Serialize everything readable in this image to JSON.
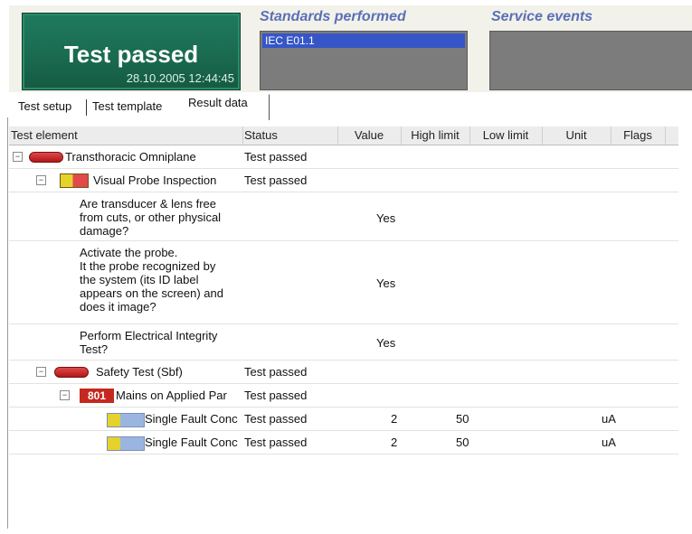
{
  "header": {
    "status_text": "Test passed",
    "status_timestamp": "28.10.2005 12:44:45",
    "standards_title": "Standards performed",
    "standards_items": [
      "IEC E01.1"
    ],
    "service_title": "Service events"
  },
  "tabs": [
    {
      "label": "Test setup"
    },
    {
      "label": "Test template"
    },
    {
      "label": "Result data"
    }
  ],
  "table": {
    "columns": [
      "Test element",
      "Status",
      "Value",
      "High limit",
      "Low limit",
      "Unit",
      "Flags"
    ],
    "rows": [
      {
        "element": "Transthoracic Omniplane",
        "status": "Test passed",
        "value": "",
        "high": "",
        "low": "",
        "unit": "",
        "flags": ""
      },
      {
        "element": "Visual Probe Inspection",
        "status": "Test passed",
        "value": "",
        "high": "",
        "low": "",
        "unit": "",
        "flags": ""
      },
      {
        "element": "Are transducer & lens free\nfrom cuts, or other physical\ndamage?",
        "status": "",
        "value": "Yes",
        "high": "",
        "low": "",
        "unit": "",
        "flags": ""
      },
      {
        "element": "Activate the probe.\nIt the probe recognized by\nthe system (its ID label\nappears on the screen) and\ndoes it image?",
        "status": "",
        "value": "Yes",
        "high": "",
        "low": "",
        "unit": "",
        "flags": ""
      },
      {
        "element": "Perform Electrical Integrity\nTest?",
        "status": "",
        "value": "Yes",
        "high": "",
        "low": "",
        "unit": "",
        "flags": ""
      },
      {
        "element": "Safety Test (Sbf)",
        "status": "Test passed",
        "value": "",
        "high": "",
        "low": "",
        "unit": "",
        "flags": ""
      },
      {
        "element": "Mains on Applied Par",
        "status": "Test passed",
        "value": "",
        "high": "",
        "low": "",
        "unit": "",
        "flags": ""
      },
      {
        "element": "Single Fault Conc",
        "status": "Test passed",
        "value": "2",
        "high": "50",
        "low": "",
        "unit": "uA",
        "flags": ""
      },
      {
        "element": "Single Fault Conc",
        "status": "Test passed",
        "value": "2",
        "high": "50",
        "low": "",
        "unit": "uA",
        "flags": ""
      }
    ]
  },
  "icons": {
    "expand": "minus-expander-icon",
    "device": "probe-device-icon",
    "visual": "visual-inspection-icon",
    "mains": "801-test-icon",
    "single_fault": "single-fault-icon"
  },
  "icon_labels": {
    "mains_code": "801"
  },
  "colors": {
    "status_bg": "#1a6b50",
    "section_title": "#5a6fb8",
    "selection": "#3656c8",
    "device_red": "#c4281e"
  }
}
